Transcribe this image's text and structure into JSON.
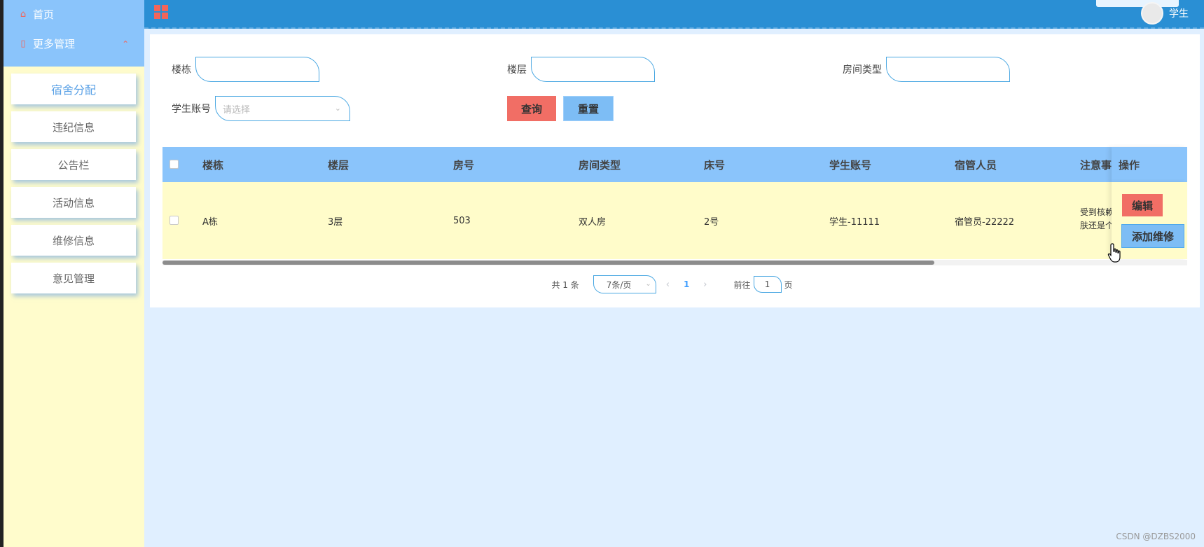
{
  "sidebar": {
    "home_label": "首页",
    "more_label": "更多管理",
    "items": [
      {
        "label": "宿舍分配"
      },
      {
        "label": "违纪信息"
      },
      {
        "label": "公告栏"
      },
      {
        "label": "活动信息"
      },
      {
        "label": "维修信息"
      },
      {
        "label": "意见管理"
      }
    ]
  },
  "header": {
    "user_name": "学生"
  },
  "filters": {
    "building_label": "楼栋",
    "floor_label": "楼层",
    "room_type_label": "房间类型",
    "student_account_label": "学生账号",
    "student_account_placeholder": "请选择",
    "query_button": "查询",
    "reset_button": "重置"
  },
  "table": {
    "columns": [
      "楼栋",
      "楼层",
      "房号",
      "房间类型",
      "床号",
      "学生账号",
      "宿管人员",
      "注意事",
      "操作"
    ],
    "rows": [
      {
        "building": "A栋",
        "floor": "3层",
        "room": "503",
        "room_type": "双人房",
        "bed": "2号",
        "student": "学生-11111",
        "manager": "宿管员-22222",
        "note_line1": "受到核赖",
        "note_line2": "肤还是个"
      }
    ],
    "edit_button": "编辑",
    "add_repair_button": "添加维修"
  },
  "pagination": {
    "total": "共 1 条",
    "page_size": "7条/页",
    "current_page": "1",
    "goto_label": "前往",
    "goto_value": "1",
    "page_suffix": "页"
  },
  "watermark": "CSDN @DZBS2000",
  "colors": {
    "sidebar_bg": "#fffccc",
    "sidebar_top": "#8ac4fb",
    "header_bg": "#2a8fd4",
    "accent_red": "#f16e65",
    "accent_blue": "#7dbdf5",
    "page_bg": "#e0efff"
  }
}
